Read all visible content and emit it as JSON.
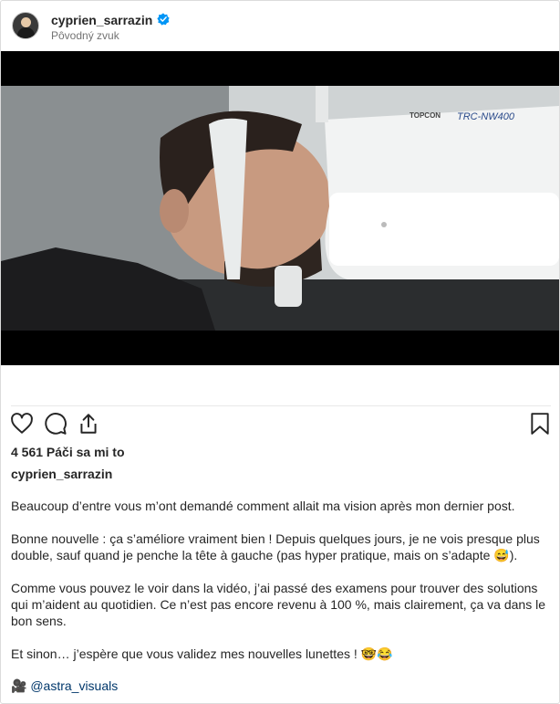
{
  "header": {
    "username": "cyprien_sarrazin",
    "audio_label": "Pôvodný zvuk"
  },
  "media": {
    "brand_text": "TOPCON",
    "model_text": "TRC-NW400"
  },
  "post": {
    "likes_text": "4 561 Páči sa mi to",
    "owner_username": "cyprien_sarrazin",
    "caption": [
      "Beaucoup d’entre vous m’ont demandé comment allait ma vision après mon dernier post.",
      "Bonne nouvelle : ça s’améliore vraiment bien ! Depuis quelques jours, je ne vois presque plus double, sauf quand je penche la tête à gauche (pas hyper pratique, mais on s’adapte 😅).",
      "Comme vous pouvez le voir dans la vidéo, j’ai passé des examens pour trouver des solutions qui m’aident au quotidien. Ce n’est pas encore revenu à 100 %, mais clairement, ça va dans le bon sens.",
      "Et sinon… j’espère que vous validez mes nouvelles lunettes ! 🤓😂"
    ],
    "credit_emoji": "🎥",
    "credit_handle": "@astra_visuals"
  },
  "icons": {
    "like": "heart-icon",
    "comment": "comment-icon",
    "share": "share-icon",
    "save": "bookmark-icon",
    "verified": "verified-badge-icon"
  },
  "colors": {
    "verified": "#0095f6",
    "link": "#00376b",
    "secondary_text": "#737373"
  }
}
